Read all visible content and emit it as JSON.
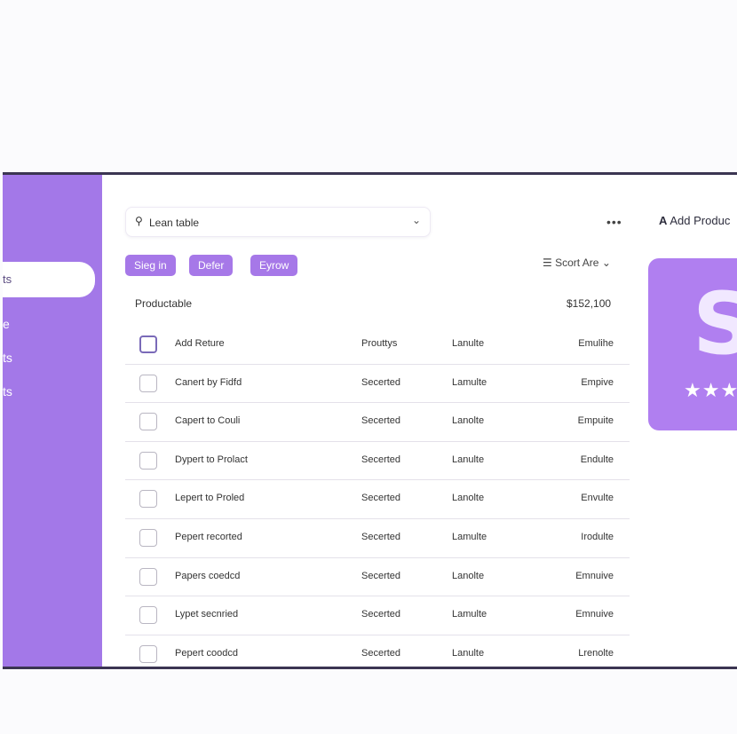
{
  "sidebar": {
    "active_label": "ts",
    "items": [
      "e",
      "ts",
      "ts"
    ]
  },
  "search": {
    "icon": "search-icon",
    "label": "Lean table",
    "chevron": "chevron-down-icon"
  },
  "toolbar": {
    "more_label": "•••",
    "add_product_label": "Add Produc",
    "add_product_icon": "A"
  },
  "pills": [
    "Sieg in",
    "Defer",
    "Eyrow"
  ],
  "sort": {
    "label": "Scort Are"
  },
  "table": {
    "title": "Productable",
    "total": "$152,100",
    "rows": [
      [
        "Add Reture",
        "Prouttys",
        "Lanulte",
        "Emulihe"
      ],
      [
        "Canert by Fidfd",
        "Secerted",
        "Lamulte",
        "Empive"
      ],
      [
        "Capert to Couli",
        "Secerted",
        "Lanolte",
        "Empuite"
      ],
      [
        "Dypert to Prolact",
        "Secerted",
        "Lanulte",
        "Endulte"
      ],
      [
        "Lepert to Proled",
        "Secerted",
        "Lanolte",
        "Envulte"
      ],
      [
        "Pepert recorted",
        "Secerted",
        "Lamulte",
        "Irodulte"
      ],
      [
        "Papers coedcd",
        "Secerted",
        "Lanolte",
        "Emnuive"
      ],
      [
        "Lypet secnried",
        "Secerted",
        "Lamulte",
        "Emnuive"
      ],
      [
        "Pepert coodcd",
        "Secerted",
        "Lanulte",
        "Lrenolte"
      ]
    ]
  },
  "card": {
    "logo": "S",
    "stars": "★★★"
  },
  "colors": {
    "accent": "#a678e8",
    "sidebar": "#a378e8",
    "frame_border": "#3b3552"
  }
}
